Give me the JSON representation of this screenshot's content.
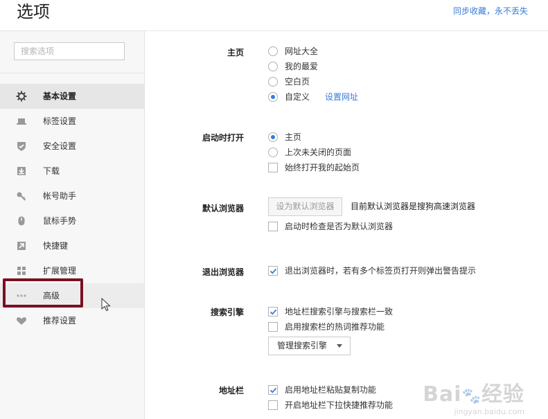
{
  "header": {
    "title": "选项",
    "sync_link": "同步收藏，永不丢失"
  },
  "sidebar": {
    "search_placeholder": "搜索选项",
    "items": [
      {
        "label": "基本设置",
        "icon": "gear-icon"
      },
      {
        "label": "标签设置",
        "icon": "tab-icon"
      },
      {
        "label": "安全设置",
        "icon": "shield-check-icon"
      },
      {
        "label": "下载",
        "icon": "download-icon"
      },
      {
        "label": "帐号助手",
        "icon": "key-icon"
      },
      {
        "label": "鼠标手势",
        "icon": "mouse-icon"
      },
      {
        "label": "快捷键",
        "icon": "shortcut-arrow-icon"
      },
      {
        "label": "扩展管理",
        "icon": "extension-icon"
      },
      {
        "label": "高级",
        "icon": "more-dots-icon"
      },
      {
        "label": "推荐设置",
        "icon": "heart-icon"
      }
    ],
    "active_index": 0,
    "hover_index": 8
  },
  "homepage": {
    "label": "主页",
    "options": [
      "网址大全",
      "我的最爱",
      "空白页",
      "自定义"
    ],
    "selected": 3,
    "set_url_link": "设置网址"
  },
  "startup": {
    "label": "启动时打开",
    "options": [
      "主页",
      "上次未关闭的页面"
    ],
    "selected": 0,
    "always_open_start": "始终打开我的起始页",
    "always_open_checked": false
  },
  "default_browser": {
    "label": "默认浏览器",
    "set_default_button": "设为默认浏览器",
    "status": "目前默认浏览器是搜狗高速浏览器",
    "check_on_start": "启动时检查是否为默认浏览器",
    "check_on_start_checked": false
  },
  "exit_browser": {
    "label": "退出浏览器",
    "warn_multi_tabs": "退出浏览器时，若有多个标签页打开则弹出警告提示",
    "warn_checked": true
  },
  "search_engine": {
    "label": "搜索引擎",
    "sync_address_bar": "地址栏搜索引擎与搜索栏一致",
    "sync_checked": true,
    "hot_words": "启用搜索栏的热词推荐功能",
    "hot_words_checked": false,
    "manage_button": "管理搜索引擎"
  },
  "address_bar": {
    "label": "地址栏",
    "paste_copy": "启用地址栏粘贴复制功能",
    "paste_copy_checked": true,
    "dropdown_recommend": "开启地址栏下拉快捷推荐功能",
    "dropdown_recommend_checked": false
  },
  "watermark": {
    "logo": "Bai",
    "logo_tail": "经验",
    "url": "jingyan.baidu.com"
  },
  "colors": {
    "accent": "#3a7bd5",
    "highlight_border": "#7a1022",
    "sidebar_bg": "#f7f7f7"
  }
}
